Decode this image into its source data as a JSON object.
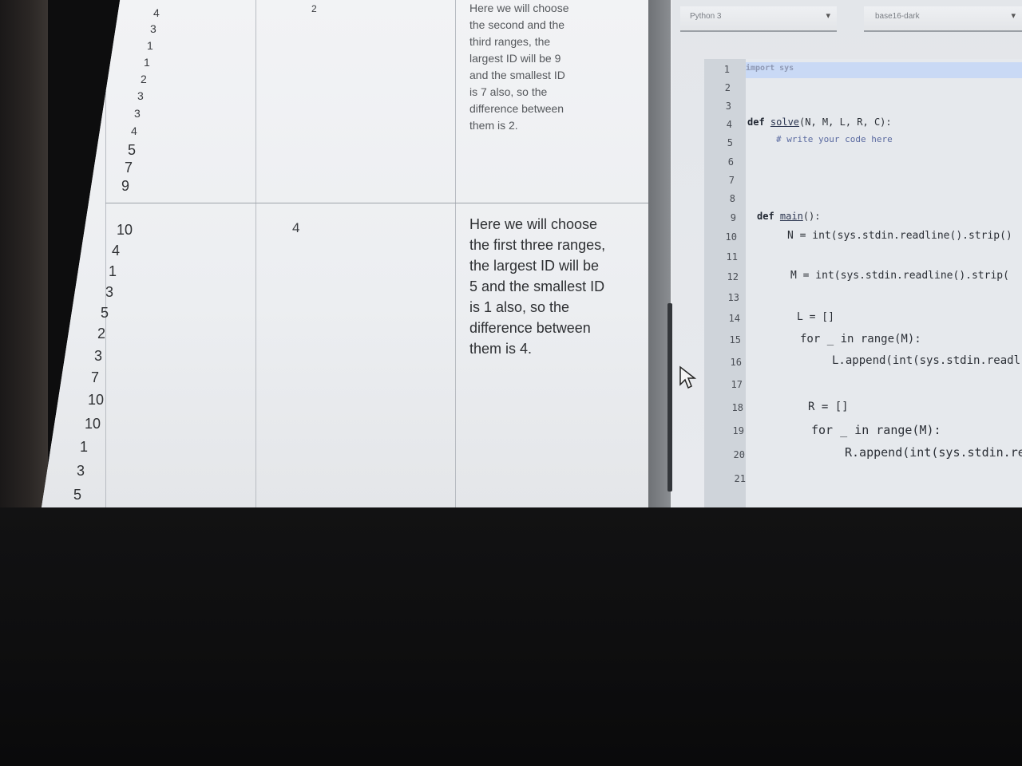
{
  "table": {
    "upper_row": {
      "input_numbers": [
        "4",
        "3",
        "1",
        "1",
        "2",
        "3",
        "3",
        "4",
        "5",
        "7",
        "9"
      ],
      "output": "2",
      "note": "Here we will choose\nthe second and the\nthird ranges, the\nlargest ID will be 9\nand the smallest ID\nis 7 also, so the\ndifference between\nthem is 2."
    },
    "lower_row": {
      "input_numbers": [
        "10",
        "4",
        "1",
        "3",
        "5",
        "2",
        "3",
        "7",
        "10",
        "10",
        "1",
        "3",
        "5"
      ],
      "output": "4",
      "note": "Here we will choose\nthe first three ranges,\nthe largest ID will be\n5 and the smallest ID\nis 1 also, so the\ndifference between\nthem is 4."
    }
  },
  "editor": {
    "language_select": "Python 3",
    "theme_select": "base16-dark",
    "line_numbers": [
      "1",
      "2",
      "3",
      "4",
      "5",
      "6",
      "7",
      "8",
      "9",
      "10",
      "11",
      "12",
      "13",
      "14",
      "15",
      "16",
      "17",
      "18",
      "19",
      "20",
      "21"
    ],
    "code_lines": {
      "l1": "import sys",
      "l4_kw": "def ",
      "l4_fn": "solve",
      "l4_rest": "(N, M, L, R, C):",
      "l5": "# write your code here",
      "l9_kw": "def ",
      "l9_fn": "main",
      "l9_rest": "():",
      "l10": "N = int(sys.stdin.readline().strip()",
      "l12": "M = int(sys.stdin.readline().strip(",
      "l14": "L = []",
      "l15": "for _ in range(M):",
      "l16": "L.append(int(sys.stdin.readl",
      "l18": "R = []",
      "l19": "for _ in range(M):",
      "l20": "R.append(int(sys.stdin.re"
    }
  }
}
